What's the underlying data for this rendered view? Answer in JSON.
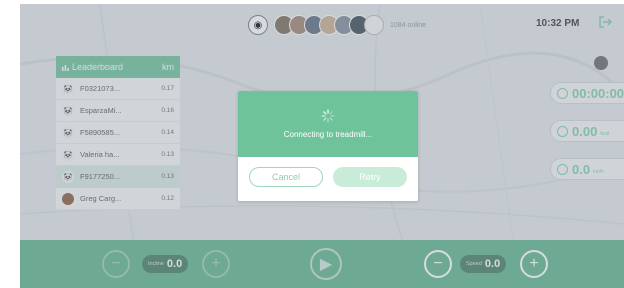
{
  "header": {
    "online_count": "1084 online",
    "time": "10:32 PM"
  },
  "icons": {
    "exit": "exit-icon",
    "bluetooth": "bluetooth-icon",
    "timer": "timer-icon",
    "calories": "flame-icon",
    "speed": "speedometer-icon",
    "spinner": "loading-spinner-icon",
    "chart": "bar-chart-icon"
  },
  "colors": {
    "accent": "#6cc39a",
    "bar": "#5fb48d"
  },
  "leaderboard": {
    "title": "Leaderboard",
    "unit": "km",
    "rows": [
      {
        "name": "F0321073...",
        "km": "0.17"
      },
      {
        "name": "EsparzaMi...",
        "km": "0.16"
      },
      {
        "name": "F5890585...",
        "km": "0.14"
      },
      {
        "name": "Valeria ha...",
        "km": "0.13"
      },
      {
        "name": "F9177250...",
        "km": "0.13"
      },
      {
        "name": "Greg Carg...",
        "km": "0.12"
      }
    ]
  },
  "stats": {
    "time": "00:00:00",
    "calories": "0.00",
    "calories_unit": "kcal",
    "speed": "0.0",
    "speed_unit": "km/h"
  },
  "controls": {
    "incline_label": "Incline",
    "incline_value": "0.0",
    "speed_label": "Speed",
    "speed_value": "0.0"
  },
  "dialog": {
    "message": "Connecting to treadmill...",
    "cancel": "Cancel",
    "retry": "Retry"
  }
}
